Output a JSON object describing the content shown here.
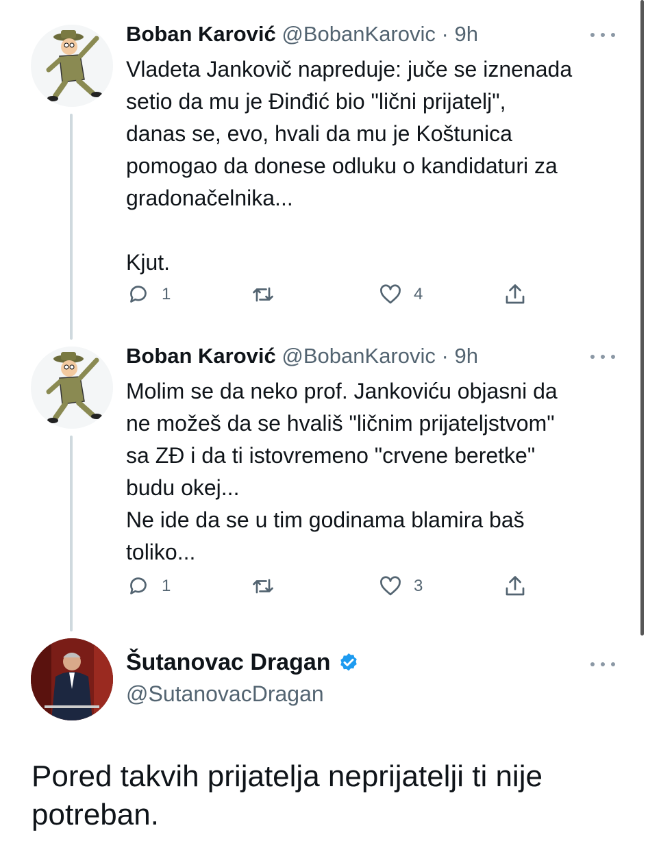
{
  "tweets": [
    {
      "name": "Boban Karović",
      "handle": "@BobanKarovic",
      "separator": "·",
      "time": "9h",
      "text": "Vladeta Jankovič napreduje: juče se iznenada\nsetio da mu je Đinđić bio \"lični prijatelj\",\ndanas se, evo, hvali da mu je Koštunica\npomogao da donese odluku o kandidaturi za\ngradonačelnika...\n\nKjut.",
      "replies": "1",
      "likes": "4"
    },
    {
      "name": "Boban Karović",
      "handle": "@BobanKarovic",
      "separator": "·",
      "time": "9h",
      "text": "Molim se da neko prof. Jankoviću objasni da\nne možeš da se hvališ \"ličnim prijateljstvom\"\nsa ZĐ i da ti istovremeno \"crvene beretke\"\nbudu okej...\nNe ide da se u tim godinama blamira baš\ntoliko...",
      "replies": "1",
      "likes": "3"
    }
  ],
  "main_tweet": {
    "name": "Šutanovac Dragan",
    "handle": "@SutanovacDragan",
    "verified": true,
    "text": "Pored takvih prijatelja neprijatelji ti nije potreban."
  },
  "icons": {
    "reply": "reply-bubble-icon",
    "retweet": "retweet-icon",
    "like": "heart-icon",
    "share": "share-icon",
    "more": "more-dots-icon",
    "verified": "verified-badge-icon"
  },
  "colors": {
    "text": "#0f1419",
    "secondary": "#536471",
    "verified": "#1d9bf0",
    "thread_line": "#cfd9de"
  }
}
